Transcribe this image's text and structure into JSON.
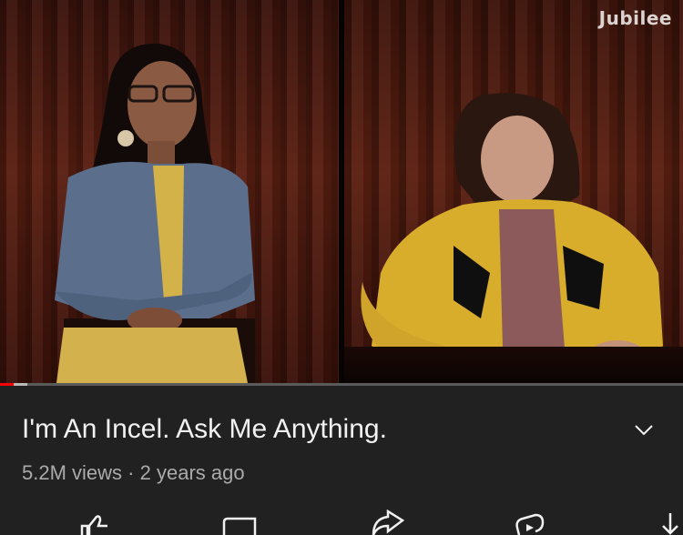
{
  "video": {
    "watermark": "Jubilee",
    "progress_fraction": 0.02,
    "buffer_fraction": 0.04
  },
  "details": {
    "title": "I'm An Incel. Ask Me Anything.",
    "views": "5.2M views",
    "separator": "·",
    "age": "2 years ago"
  },
  "icons": {
    "expand": "chevron-down-icon",
    "actions": [
      "thumbs-up-icon",
      "thumbs-down-icon",
      "share-icon",
      "remix-icon",
      "download-icon"
    ]
  },
  "colors": {
    "background": "#212121",
    "title_text": "#f1f1f1",
    "meta_text": "#aaaaaa",
    "progress": "#ff0000"
  }
}
